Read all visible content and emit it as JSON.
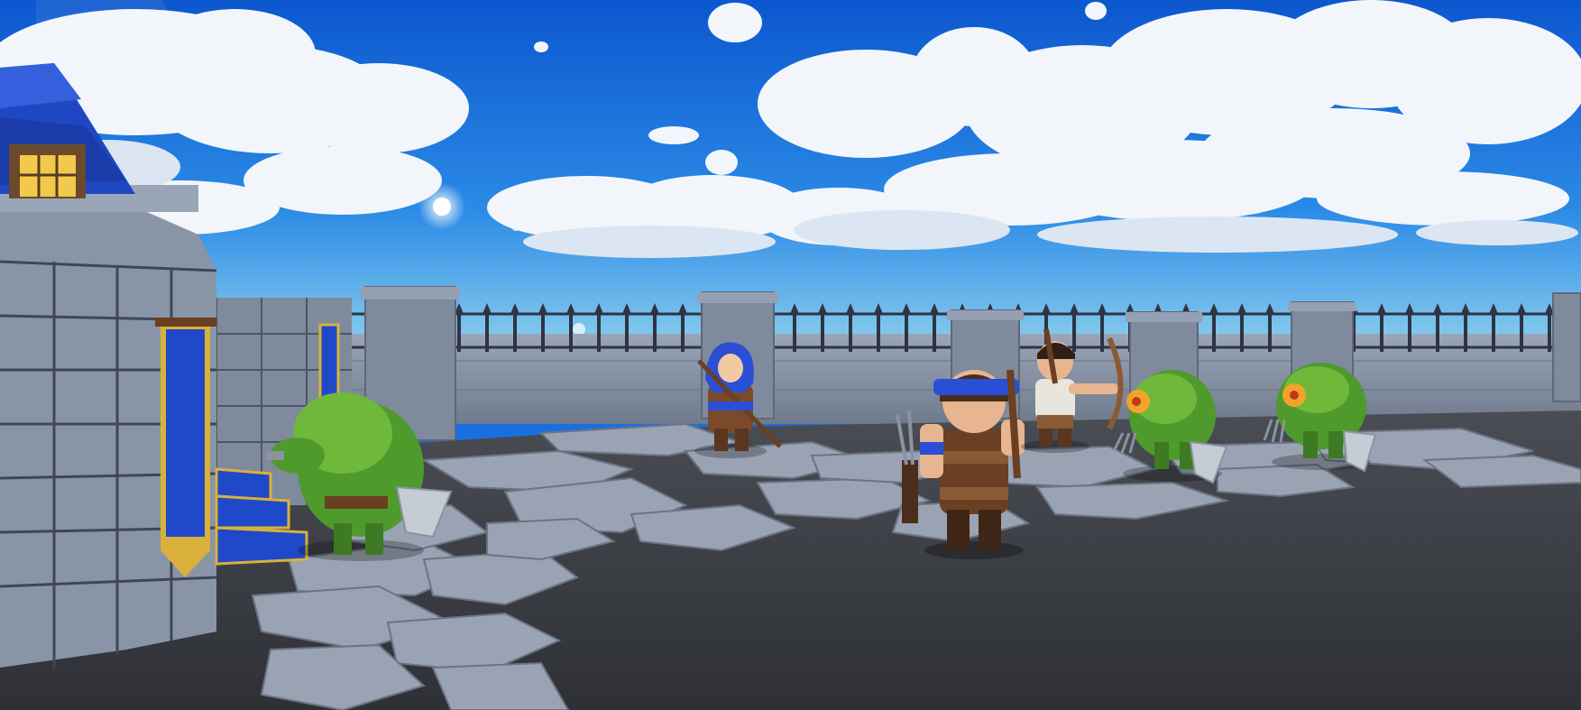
{
  "scene": {
    "type": "3d-game-viewport",
    "setting": "castle-rampart-battle",
    "colors": {
      "sky_top": "#0d5fd6",
      "sky_horizon": "#8fd3ee",
      "cloud": "#f2f6fb",
      "cloud_shade": "#b9c7da",
      "stone_wall": "#8d99ab",
      "stone_dark": "#5e6878",
      "floor": "#3a3d44",
      "paving": "#9aa3b3",
      "banner_blue": "#1f49c9",
      "banner_gold": "#d9b13a",
      "roof_blue": "#1f47c4",
      "goblin_green": "#4f9a2c",
      "leather_brown": "#6b3f22",
      "hood_blue": "#2a4fd6"
    }
  },
  "characters": [
    {
      "kind": "goblin-enemy",
      "icon": "goblin-with-shield"
    },
    {
      "kind": "hooded-archer",
      "icon": "archer-blue-hood"
    },
    {
      "kind": "player-archer",
      "icon": "archer-blue-headband"
    },
    {
      "kind": "bow-archer",
      "icon": "archer-white-shirt"
    },
    {
      "kind": "goblin-enemy",
      "icon": "goblin-with-claws"
    },
    {
      "kind": "goblin-enemy",
      "icon": "goblin-with-claws"
    }
  ]
}
